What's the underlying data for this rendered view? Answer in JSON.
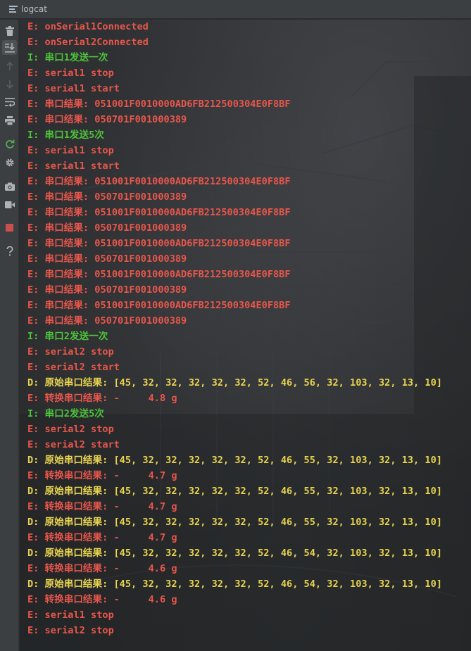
{
  "window": {
    "title": "logcat"
  },
  "toolbar": {
    "icons": [
      "trash-icon",
      "scroll-to-end-icon",
      "arrow-up-icon",
      "arrow-down-icon",
      "soft-wrap-icon",
      "print-icon",
      "restart-icon",
      "gear-icon",
      "camera-icon",
      "video-icon",
      "stop-icon",
      "help-icon"
    ]
  },
  "colors": {
    "error": "#e8564b",
    "info": "#4ec23a",
    "debug": "#e8d34f"
  },
  "log": [
    {
      "level": "E",
      "text": "E: onSerial1Connected"
    },
    {
      "level": "E",
      "text": "E: onSerial2Connected"
    },
    {
      "level": "I",
      "text": "I: 串口1发送一次"
    },
    {
      "level": "E",
      "text": "E: serial1 stop"
    },
    {
      "level": "E",
      "text": "E: serial1 start"
    },
    {
      "level": "E",
      "text": "E: 串口结果: 051001F0010000AD6FB212500304E0F8BF"
    },
    {
      "level": "E",
      "text": "E: 串口结果: 050701F001000389"
    },
    {
      "level": "I",
      "text": "I: 串口1发送5次"
    },
    {
      "level": "E",
      "text": "E: serial1 stop"
    },
    {
      "level": "E",
      "text": "E: serial1 start"
    },
    {
      "level": "E",
      "text": "E: 串口结果: 051001F0010000AD6FB212500304E0F8BF"
    },
    {
      "level": "E",
      "text": "E: 串口结果: 050701F001000389"
    },
    {
      "level": "E",
      "text": "E: 串口结果: 051001F0010000AD6FB212500304E0F8BF"
    },
    {
      "level": "E",
      "text": "E: 串口结果: 050701F001000389"
    },
    {
      "level": "E",
      "text": "E: 串口结果: 051001F0010000AD6FB212500304E0F8BF"
    },
    {
      "level": "E",
      "text": "E: 串口结果: 050701F001000389"
    },
    {
      "level": "E",
      "text": "E: 串口结果: 051001F0010000AD6FB212500304E0F8BF"
    },
    {
      "level": "E",
      "text": "E: 串口结果: 050701F001000389"
    },
    {
      "level": "E",
      "text": "E: 串口结果: 051001F0010000AD6FB212500304E0F8BF"
    },
    {
      "level": "E",
      "text": "E: 串口结果: 050701F001000389"
    },
    {
      "level": "I",
      "text": "I: 串口2发送一次"
    },
    {
      "level": "E",
      "text": "E: serial2 stop"
    },
    {
      "level": "E",
      "text": "E: serial2 start"
    },
    {
      "level": "D",
      "text": "D: 原始串口结果: [45, 32, 32, 32, 32, 32, 52, 46, 56, 32, 103, 32, 13, 10]"
    },
    {
      "level": "E",
      "text": "E: 转换串口结果: -     4.8 g"
    },
    {
      "level": "I",
      "text": "I: 串口2发送5次"
    },
    {
      "level": "E",
      "text": "E: serial2 stop"
    },
    {
      "level": "E",
      "text": "E: serial2 start"
    },
    {
      "level": "D",
      "text": "D: 原始串口结果: [45, 32, 32, 32, 32, 32, 52, 46, 55, 32, 103, 32, 13, 10]"
    },
    {
      "level": "E",
      "text": "E: 转换串口结果: -     4.7 g"
    },
    {
      "level": "D",
      "text": "D: 原始串口结果: [45, 32, 32, 32, 32, 32, 52, 46, 55, 32, 103, 32, 13, 10]"
    },
    {
      "level": "E",
      "text": "E: 转换串口结果: -     4.7 g"
    },
    {
      "level": "D",
      "text": "D: 原始串口结果: [45, 32, 32, 32, 32, 32, 52, 46, 55, 32, 103, 32, 13, 10]"
    },
    {
      "level": "E",
      "text": "E: 转换串口结果: -     4.7 g"
    },
    {
      "level": "D",
      "text": "D: 原始串口结果: [45, 32, 32, 32, 32, 32, 52, 46, 54, 32, 103, 32, 13, 10]"
    },
    {
      "level": "E",
      "text": "E: 转换串口结果: -     4.6 g"
    },
    {
      "level": "D",
      "text": "D: 原始串口结果: [45, 32, 32, 32, 32, 32, 52, 46, 54, 32, 103, 32, 13, 10]"
    },
    {
      "level": "E",
      "text": "E: 转换串口结果: -     4.6 g"
    },
    {
      "level": "E",
      "text": "E: serial1 stop"
    },
    {
      "level": "E",
      "text": "E: serial2 stop"
    }
  ]
}
